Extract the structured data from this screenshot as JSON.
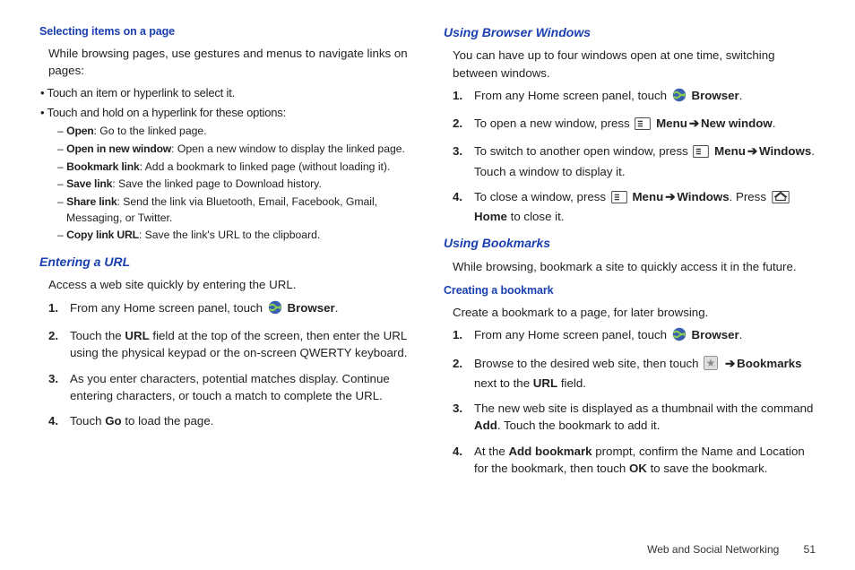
{
  "left": {
    "h1": "Selecting items on a page",
    "p1": "While browsing pages, use gestures and menus to navigate links on pages:",
    "b1": "Touch an item or hyperlink to select it.",
    "b2": "Touch and hold on a hyperlink for these options:",
    "d1a": "Open",
    "d1b": ": Go to the linked page.",
    "d2a": "Open in new window",
    "d2b": ": Open a new window to display the linked page.",
    "d3a": "Bookmark link",
    "d3b": ": Add a bookmark to linked page (without loading it).",
    "d4a": "Save link",
    "d4b": ": Save the linked page to Download history.",
    "d5a": "Share link",
    "d5b": ": Send the link via Bluetooth, Email, Facebook, Gmail, Messaging, or Twitter.",
    "d6a": "Copy link URL",
    "d6b": ": Save the link's URL to the clipboard.",
    "h2": "Entering a URL",
    "p2": "Access a web site quickly by entering the URL.",
    "s1a": "From any Home screen panel, touch ",
    "s1b": "Browser",
    "s1c": ".",
    "s2a": "Touch the ",
    "s2b": "URL",
    "s2c": " field at the top of the screen, then enter the URL using the physical keypad or the on-screen QWERTY keyboard.",
    "s3": "As you enter characters, potential matches display. Continue entering characters, or touch a match to complete the URL.",
    "s4a": "Touch ",
    "s4b": "Go",
    "s4c": " to load the page."
  },
  "right": {
    "h1": "Using Browser Windows",
    "p1": "You can have up to four windows open at one time, switching between windows.",
    "s1a": "From any Home screen panel, touch ",
    "s1b": "Browser",
    "s1c": ".",
    "s2a": "To open a new window, press ",
    "s2b": "Menu",
    "s2c": "New window",
    "s2d": ".",
    "s3a": "To switch to another open window, press ",
    "s3b": "Menu",
    "s3c": "Windows",
    "s3d": ". Touch a window to display it.",
    "s4a": "To close a window, press ",
    "s4b": "Menu",
    "s4c": "Windows",
    "s4d": ". Press ",
    "s4e": "Home",
    "s4f": " to close it.",
    "h2": "Using Bookmarks",
    "p2": "While browsing, bookmark a site to quickly access it in the future.",
    "h3": "Creating a bookmark",
    "p3": "Create a bookmark to a page, for later browsing.",
    "t1a": "From any Home screen panel, touch ",
    "t1b": "Browser",
    "t1c": ".",
    "t2a": "Browse to the desired web site, then touch ",
    "t2b": "Bookmarks",
    "t2c": " next to the ",
    "t2d": "URL",
    "t2e": " field.",
    "t3a": "The new web site is displayed as a thumbnail with the command ",
    "t3b": "Add",
    "t3c": ". Touch the bookmark to add it.",
    "t4a": "At the ",
    "t4b": "Add bookmark",
    "t4c": " prompt, confirm the Name and Location for the bookmark, then touch ",
    "t4d": "OK",
    "t4e": " to save the bookmark."
  },
  "footer": {
    "section": "Web and Social Networking",
    "page": "51"
  }
}
